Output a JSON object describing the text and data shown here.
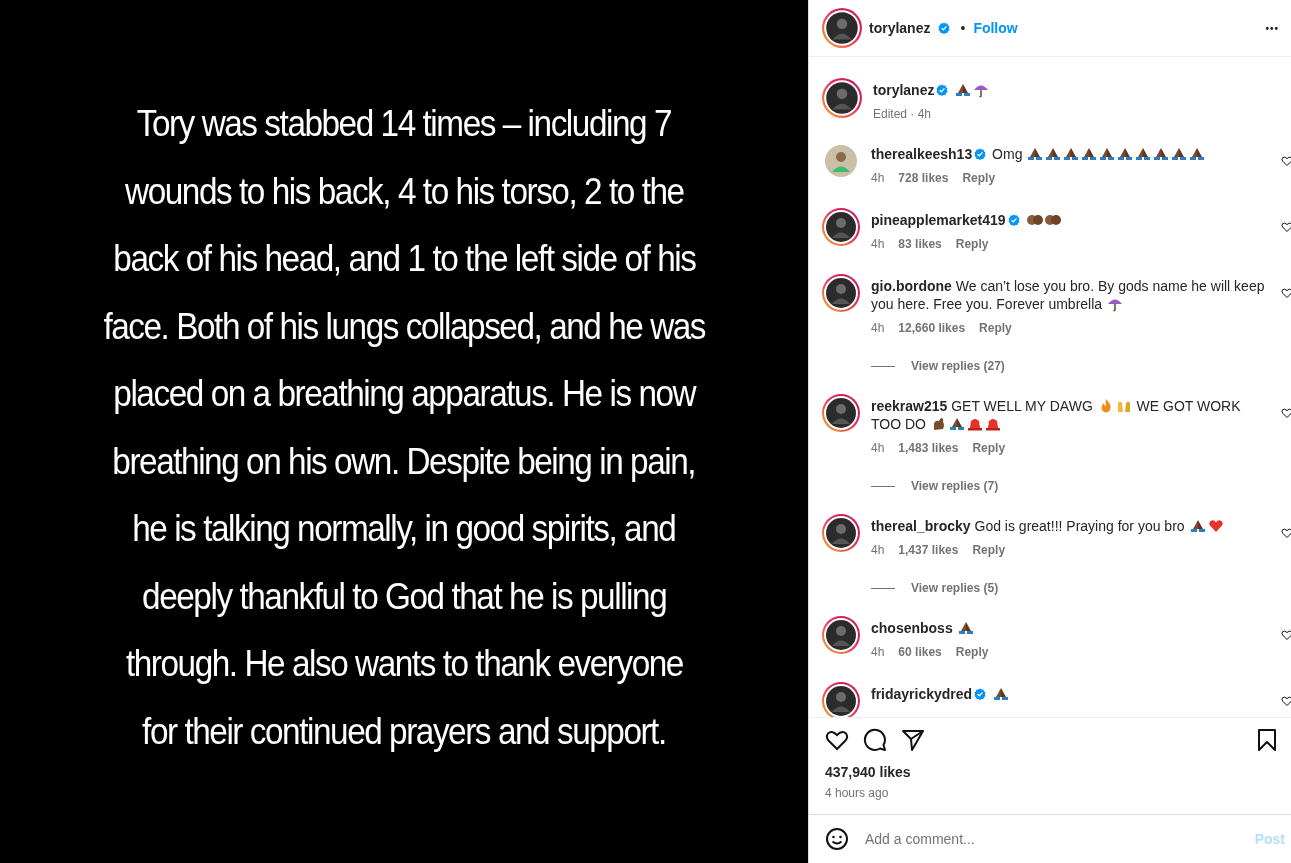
{
  "post_image": {
    "lines": [
      "Tory was stabbed 14 times – including 7",
      "wounds to his back, 4 to his torso, 2 to the",
      "back of his head, and 1 to the left side of his",
      "face. Both of his lungs collapsed, and he was",
      "placed on a breathing apparatus. He is now",
      "breathing on his own. Despite being in pain,",
      "he is talking normally, in good spirits, and",
      "deeply thankful to God that he is pulling",
      "through. He also wants to thank everyone",
      "for their continued prayers and support."
    ]
  },
  "header": {
    "username": "torylanez",
    "verified": true,
    "story_ring": true,
    "separator": "•",
    "follow": "Follow",
    "more": "•••"
  },
  "caption": {
    "username": "torylanez",
    "verified": true,
    "story_ring": true,
    "parts": [
      {
        "kind": "pray"
      },
      {
        "kind": "umbrella"
      }
    ],
    "meta": "Edited · 4h"
  },
  "comments": [
    {
      "username": "therealkeesh13",
      "verified": true,
      "story_ring": false,
      "parts": [
        {
          "kind": "text",
          "text": "Omg"
        },
        {
          "kind": "pray"
        },
        {
          "kind": "pray"
        },
        {
          "kind": "pray"
        },
        {
          "kind": "pray"
        },
        {
          "kind": "pray"
        },
        {
          "kind": "pray"
        },
        {
          "kind": "pray"
        },
        {
          "kind": "pray"
        },
        {
          "kind": "pray"
        },
        {
          "kind": "pray"
        }
      ],
      "time": "4h",
      "likes": "728 likes",
      "reply": "Reply"
    },
    {
      "username": "pineapplemarket419",
      "verified": true,
      "story_ring": true,
      "parts": [
        {
          "kind": "palms"
        },
        {
          "kind": "palms"
        }
      ],
      "time": "4h",
      "likes": "83 likes",
      "reply": "Reply"
    },
    {
      "username": "gio.bordone",
      "verified": false,
      "story_ring": true,
      "parts": [
        {
          "kind": "text",
          "text": "We can’t lose you bro. By gods name he will keep you here. Free you. Forever umbrella"
        },
        {
          "kind": "umbrella"
        }
      ],
      "time": "4h",
      "likes": "12,660 likes",
      "reply": "Reply",
      "view_replies": "View replies (27)"
    },
    {
      "username": "reekraw215",
      "verified": false,
      "story_ring": true,
      "parts": [
        {
          "kind": "text",
          "text": "GET WELL MY DAWG"
        },
        {
          "kind": "fire"
        },
        {
          "kind": "raised"
        },
        {
          "kind": "text",
          "text": "WE GOT WORK TOO DO"
        },
        {
          "kind": "flex"
        },
        {
          "kind": "pray"
        },
        {
          "kind": "siren"
        },
        {
          "kind": "siren"
        }
      ],
      "time": "4h",
      "likes": "1,483 likes",
      "reply": "Reply",
      "view_replies": "View replies (7)"
    },
    {
      "username": "thereal_brocky",
      "verified": false,
      "story_ring": true,
      "parts": [
        {
          "kind": "text",
          "text": "God is great!!! Praying for you bro"
        },
        {
          "kind": "pray"
        },
        {
          "kind": "heart"
        }
      ],
      "time": "4h",
      "likes": "1,437 likes",
      "reply": "Reply",
      "view_replies": "View replies (5)"
    },
    {
      "username": "chosenboss",
      "verified": false,
      "story_ring": true,
      "parts": [
        {
          "kind": "pray"
        }
      ],
      "time": "4h",
      "likes": "60 likes",
      "reply": "Reply"
    },
    {
      "username": "fridayrickydred",
      "verified": true,
      "story_ring": true,
      "parts": [
        {
          "kind": "pray"
        }
      ]
    }
  ],
  "likes": "437,940 likes",
  "posted": "4 hours ago",
  "comment_box": {
    "placeholder": "Add a comment...",
    "post": "Post"
  }
}
